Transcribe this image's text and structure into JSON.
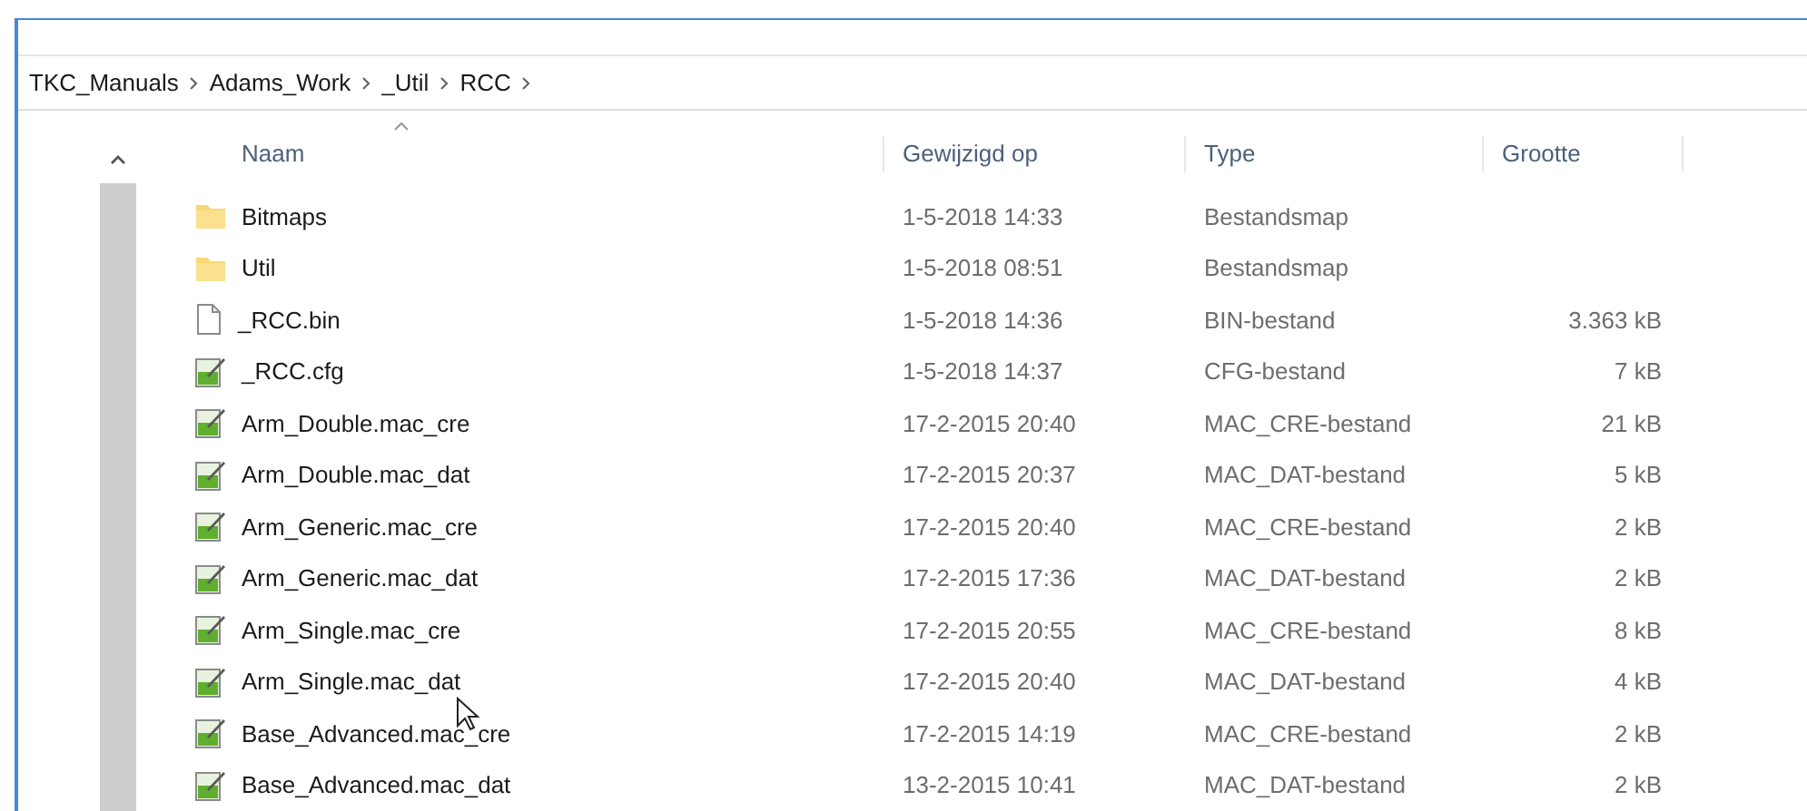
{
  "breadcrumb": [
    "TKC_Manuals",
    "Adams_Work",
    "_Util",
    "RCC"
  ],
  "columns": [
    {
      "label": "Naam",
      "sorted": true
    },
    {
      "label": "Gewijzigd op",
      "sorted": false
    },
    {
      "label": "Type",
      "sorted": false
    },
    {
      "label": "Grootte",
      "sorted": false
    }
  ],
  "rows": [
    {
      "kind": "folder",
      "name": "Bitmaps",
      "modified": "1-5-2018 14:33",
      "type": "Bestandsmap"
    },
    {
      "kind": "folder",
      "name": "Util",
      "modified": "1-5-2018 08:51",
      "type": "Bestandsmap"
    },
    {
      "kind": "blank",
      "name": "_RCC.bin",
      "modified": "1-5-2018 14:36",
      "type": "BIN-bestand",
      "size": "3.363 kB"
    },
    {
      "kind": "text",
      "name": "_RCC.cfg",
      "modified": "1-5-2018 14:37",
      "type": "CFG-bestand",
      "size": "7 kB"
    },
    {
      "kind": "text",
      "name": "Arm_Double.mac_cre",
      "modified": "17-2-2015 20:40",
      "type": "MAC_CRE-bestand",
      "size": "21 kB"
    },
    {
      "kind": "text",
      "name": "Arm_Double.mac_dat",
      "modified": "17-2-2015 20:37",
      "type": "MAC_DAT-bestand",
      "size": "5 kB"
    },
    {
      "kind": "text",
      "name": "Arm_Generic.mac_cre",
      "modified": "17-2-2015 20:40",
      "type": "MAC_CRE-bestand",
      "size": "2 kB"
    },
    {
      "kind": "text",
      "name": "Arm_Generic.mac_dat",
      "modified": "17-2-2015 17:36",
      "type": "MAC_DAT-bestand",
      "size": "2 kB"
    },
    {
      "kind": "text",
      "name": "Arm_Single.mac_cre",
      "modified": "17-2-2015 20:55",
      "type": "MAC_CRE-bestand",
      "size": "8 kB"
    },
    {
      "kind": "text",
      "name": "Arm_Single.mac_dat",
      "modified": "17-2-2015 20:40",
      "type": "MAC_DAT-bestand",
      "size": "4 kB"
    },
    {
      "kind": "text",
      "name": "Base_Advanced.mac_cre",
      "modified": "17-2-2015 14:19",
      "type": "MAC_CRE-bestand",
      "size": "2 kB"
    },
    {
      "kind": "text",
      "name": "Base_Advanced.mac_dat",
      "modified": "13-2-2015 10:41",
      "type": "MAC_DAT-bestand",
      "size": "2 kB"
    }
  ]
}
